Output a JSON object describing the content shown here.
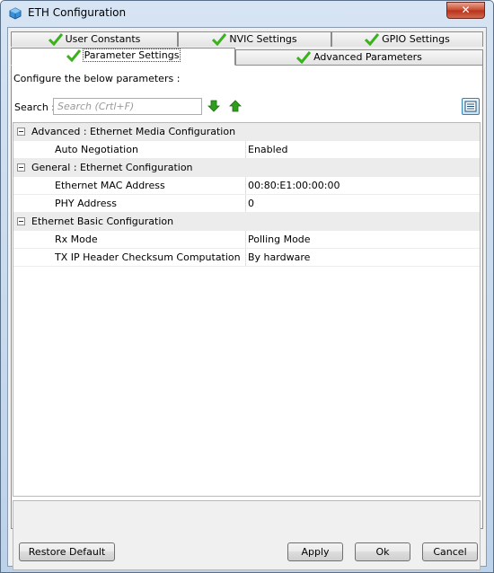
{
  "window": {
    "title": "ETH Configuration",
    "close_glyph": "✕"
  },
  "tabs_row1": [
    {
      "label": "User Constants"
    },
    {
      "label": "NVIC Settings"
    },
    {
      "label": "GPIO Settings"
    }
  ],
  "tabs_row2": [
    {
      "label": "Parameter Settings",
      "active": true
    },
    {
      "label": "Advanced Parameters",
      "active": false
    }
  ],
  "panel": {
    "configure_label": "Configure the below parameters :",
    "search_label": "Search :",
    "search_placeholder": "Search (Crtl+F)",
    "icons": [
      "check-icon",
      "arrow-down-icon",
      "arrow-up-icon",
      "list-view-icon"
    ]
  },
  "groups": [
    {
      "label": "Advanced : Ethernet Media Configuration",
      "rows": [
        {
          "name": "Auto Negotiation",
          "value": "Enabled"
        }
      ]
    },
    {
      "label": "General : Ethernet Configuration",
      "rows": [
        {
          "name": "Ethernet MAC Address",
          "value": "00:80:E1:00:00:00"
        },
        {
          "name": "PHY Address",
          "value": "0"
        }
      ]
    },
    {
      "label": "Ethernet Basic Configuration",
      "rows": [
        {
          "name": "Rx Mode",
          "value": "Polling Mode"
        },
        {
          "name": "TX IP Header Checksum Computation",
          "value": "By hardware"
        }
      ]
    }
  ],
  "buttons": {
    "restore_default": "Restore Default",
    "apply": "Apply",
    "ok": "Ok",
    "cancel": "Cancel"
  },
  "colors": {
    "check_green": "#3cb11e",
    "arrow_green": "#2e9e1c",
    "titlebar": "#c9dcf0"
  }
}
